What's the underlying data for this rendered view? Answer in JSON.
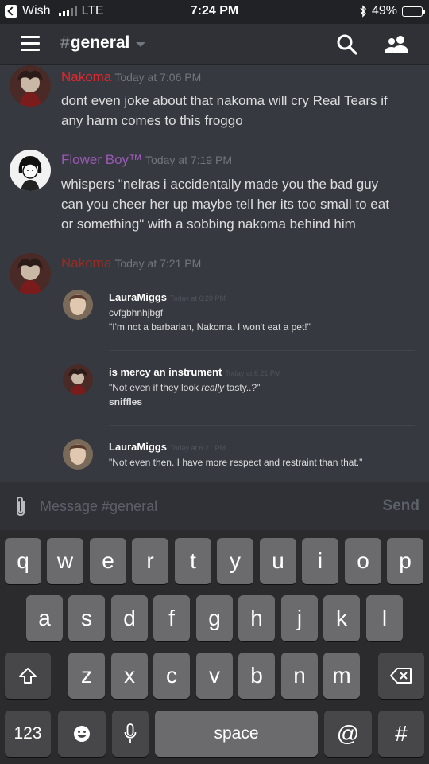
{
  "status_bar": {
    "carrier": "Wish",
    "network": "LTE",
    "time": "7:24 PM",
    "battery_percent": "49%",
    "battery_level": 0.49
  },
  "header": {
    "hash": "#",
    "channel_name": "general"
  },
  "messages": [
    {
      "author": "Nakoma",
      "author_color": "#e0282e",
      "timestamp": "Today at 7:06 PM",
      "lines": [
        "dont even joke about that nakoma will cry Real Tears if",
        "any harm comes to this froggo"
      ]
    },
    {
      "author": "Flower Boy™",
      "author_color": "#9b59b6",
      "timestamp": "Today at 7:19 PM",
      "lines": [
        "whispers \"nelras i accidentally made you the bad guy",
        "can you cheer her up maybe tell her its too small to eat",
        "or something\" with a sobbing nakoma behind him"
      ]
    },
    {
      "author": "Nakoma",
      "author_color": "#992d22",
      "timestamp": "Today at 7:21 PM",
      "embed": [
        {
          "author": "LauraMiggs",
          "timestamp": "Today at 6:20 PM",
          "lines": [
            "cvfgbhnhjbgf",
            "\"I'm not a barbarian, Nakoma.  I won't eat a pet!\""
          ]
        },
        {
          "author": "is mercy an instrument",
          "timestamp": "Today at 6:21 PM",
          "line1_pre": "\"Not even if they look ",
          "line1_em": "really",
          "line1_post": " tasty..?\"",
          "line2": "sniffles"
        },
        {
          "author": "LauraMiggs",
          "timestamp": "Today at 6:21 PM",
          "lines": [
            "\"Not even then.  I have more respect and restraint than that.\""
          ]
        }
      ]
    }
  ],
  "input": {
    "placeholder": "Message #general",
    "send_label": "Send"
  },
  "keyboard": {
    "row1": [
      "q",
      "w",
      "e",
      "r",
      "t",
      "y",
      "u",
      "i",
      "o",
      "p"
    ],
    "row2": [
      "a",
      "s",
      "d",
      "f",
      "g",
      "h",
      "j",
      "k",
      "l"
    ],
    "row3": [
      "z",
      "x",
      "c",
      "v",
      "b",
      "n",
      "m"
    ],
    "numbers_label": "123",
    "space_label": "space",
    "at_label": "@",
    "hash_label": "#"
  },
  "icons": {
    "back": "back-arrow-icon",
    "menu": "hamburger-icon",
    "search": "search-icon",
    "members": "members-icon",
    "attach": "paperclip-icon",
    "shift": "shift-icon",
    "delete": "backspace-icon",
    "emoji": "emoji-icon",
    "mic": "microphone-icon"
  },
  "colors": {
    "chat_bg": "#36393f",
    "header_bg": "#2f3136",
    "accent": "#7289da"
  }
}
